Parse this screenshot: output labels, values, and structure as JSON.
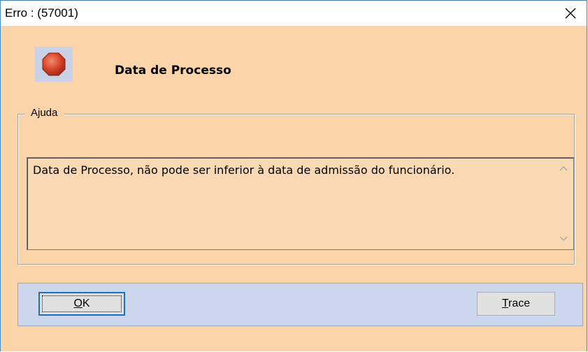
{
  "window": {
    "title": "Erro : (57001)"
  },
  "dialog": {
    "heading": "Data de Processo",
    "icon": "stop-octagon-icon",
    "help_group_label": "Ajuda",
    "message": "Data de Processo, não pode ser inferior à data de admissão do funcionário."
  },
  "buttons": {
    "ok_label": "OK",
    "trace_label": "Trace"
  },
  "colors": {
    "dialog_background": "#fbd5a9",
    "button_panel": "#ccd6ec",
    "stop_icon": "#d9452a"
  }
}
